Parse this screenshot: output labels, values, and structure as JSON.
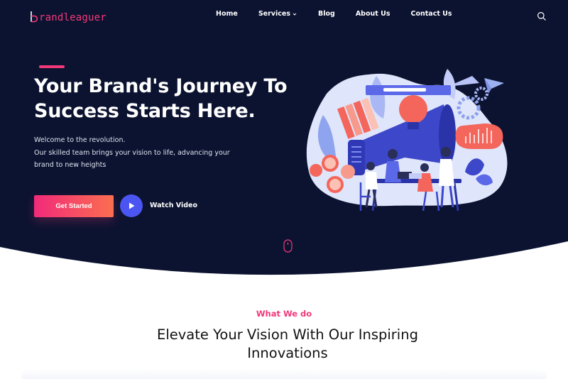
{
  "brand": {
    "logo_text": "randleaguer",
    "accent": "#f1397a",
    "hero_bg": "#0c1330"
  },
  "nav": {
    "items": [
      {
        "label": "Home"
      },
      {
        "label": "Services",
        "has_dropdown": true
      },
      {
        "label": "Blog"
      },
      {
        "label": "About Us"
      },
      {
        "label": "Contact Us"
      }
    ],
    "search_icon": "search-icon"
  },
  "hero": {
    "title_line1": "Your Brand's Journey To",
    "title_line2": "Success Starts Here.",
    "desc_line1": "Welcome to the revolution.",
    "desc_line2": "Our skilled team brings your vision to life, advancing your",
    "desc_line3": "brand to new heights",
    "cta_label": "Get Started",
    "watch_label": "Watch Video"
  },
  "section": {
    "eyebrow": "What We do",
    "title_line1": "Elevate Your Vision With Our Inspiring",
    "title_line2": "Innovations"
  }
}
